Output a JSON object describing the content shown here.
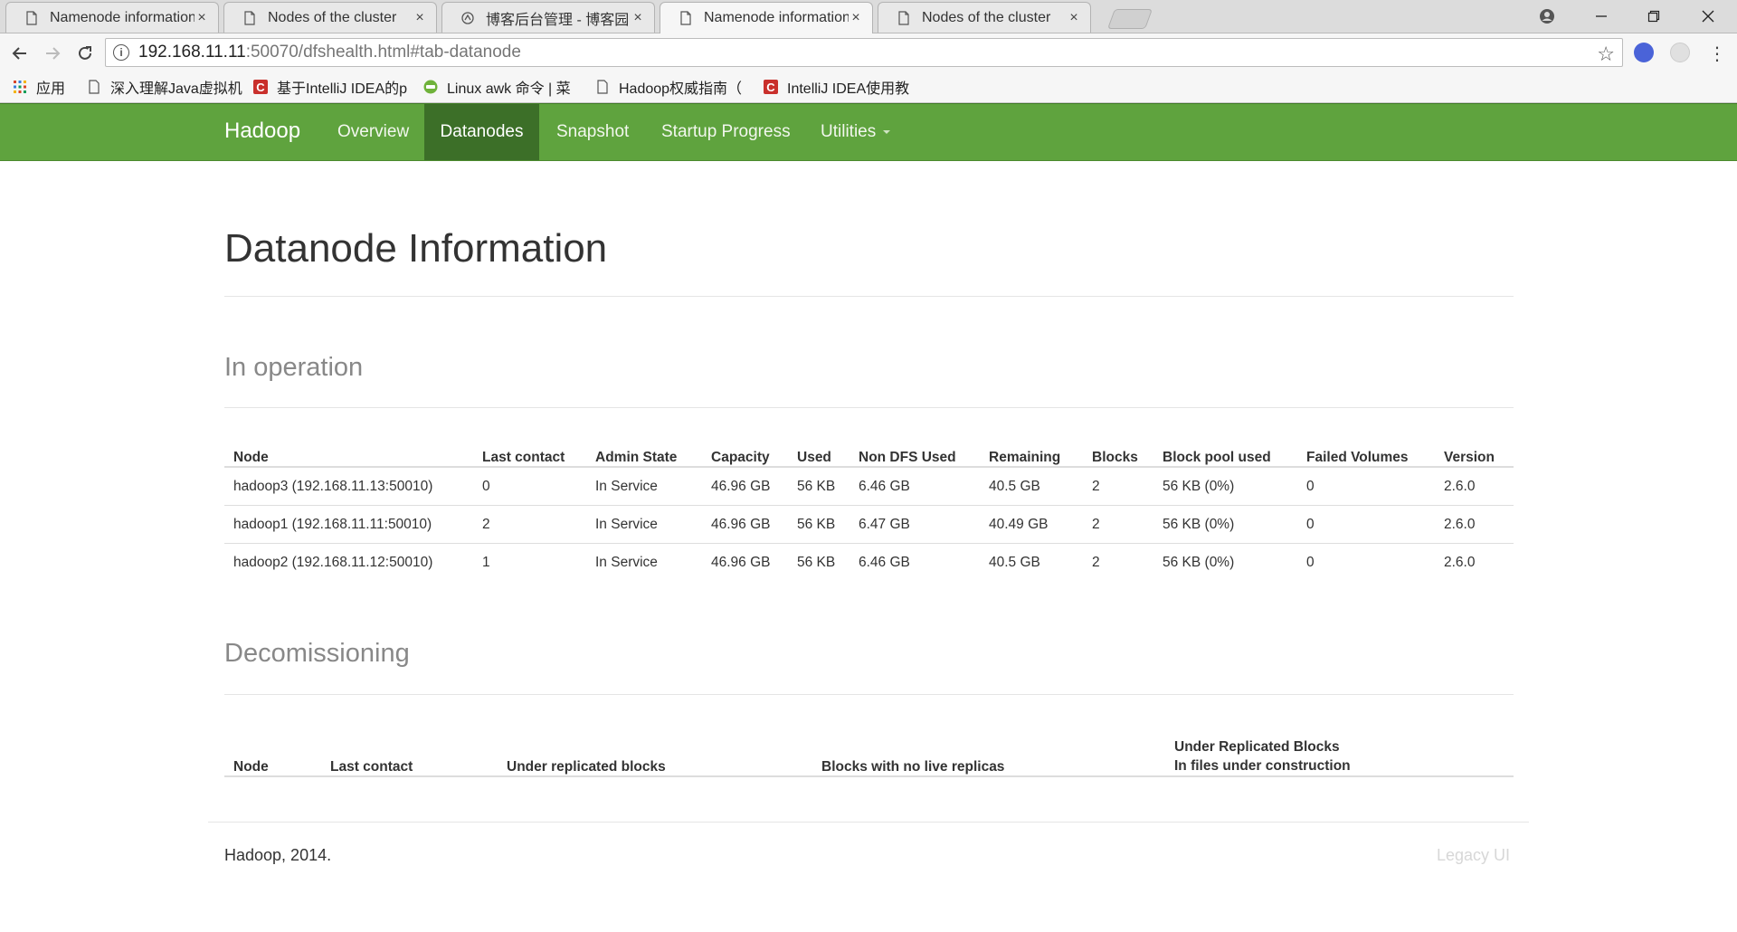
{
  "browser": {
    "tabs": [
      {
        "title": "Namenode information",
        "active": false
      },
      {
        "title": "Nodes of the cluster",
        "active": false
      },
      {
        "title": "博客后台管理 - 博客园",
        "active": false
      },
      {
        "title": "Namenode information",
        "active": true
      },
      {
        "title": "Nodes of the cluster",
        "active": false
      }
    ],
    "tab_close": "×",
    "url_host": "192.168.11.11",
    "url_rest": ":50070/dfshealth.html#tab-datanode",
    "bookmarks": [
      "应用",
      "深入理解Java虚拟机",
      "基于IntelliJ IDEA的p",
      "Linux awk 命令 | 菜",
      "Hadoop权威指南（",
      "IntelliJ IDEA使用教"
    ]
  },
  "navbar": {
    "brand": "Hadoop",
    "items": [
      "Overview",
      "Datanodes",
      "Snapshot",
      "Startup Progress",
      "Utilities"
    ],
    "active": "Datanodes",
    "color": "#5fa33e",
    "active_color": "#3c6f28"
  },
  "page": {
    "title": "Datanode Information",
    "in_operation": {
      "heading": "In operation",
      "columns": [
        "Node",
        "Last contact",
        "Admin State",
        "Capacity",
        "Used",
        "Non DFS Used",
        "Remaining",
        "Blocks",
        "Block pool used",
        "Failed Volumes",
        "Version"
      ],
      "rows": [
        [
          "hadoop3 (192.168.11.13:50010)",
          "0",
          "In Service",
          "46.96 GB",
          "56 KB",
          "6.46 GB",
          "40.5 GB",
          "2",
          "56 KB (0%)",
          "0",
          "2.6.0"
        ],
        [
          "hadoop1 (192.168.11.11:50010)",
          "2",
          "In Service",
          "46.96 GB",
          "56 KB",
          "6.47 GB",
          "40.49 GB",
          "2",
          "56 KB (0%)",
          "0",
          "2.6.0"
        ],
        [
          "hadoop2 (192.168.11.12:50010)",
          "1",
          "In Service",
          "46.96 GB",
          "56 KB",
          "6.46 GB",
          "40.5 GB",
          "2",
          "56 KB (0%)",
          "0",
          "2.6.0"
        ]
      ]
    },
    "decomissioning": {
      "heading": "Decomissioning",
      "columns": [
        "Node",
        "Last contact",
        "Under replicated blocks",
        "Blocks with no live replicas"
      ],
      "last_column_line1": "Under Replicated Blocks",
      "last_column_line2": "In files under construction"
    },
    "footer": {
      "left": "Hadoop, 2014.",
      "right": "Legacy UI"
    }
  }
}
